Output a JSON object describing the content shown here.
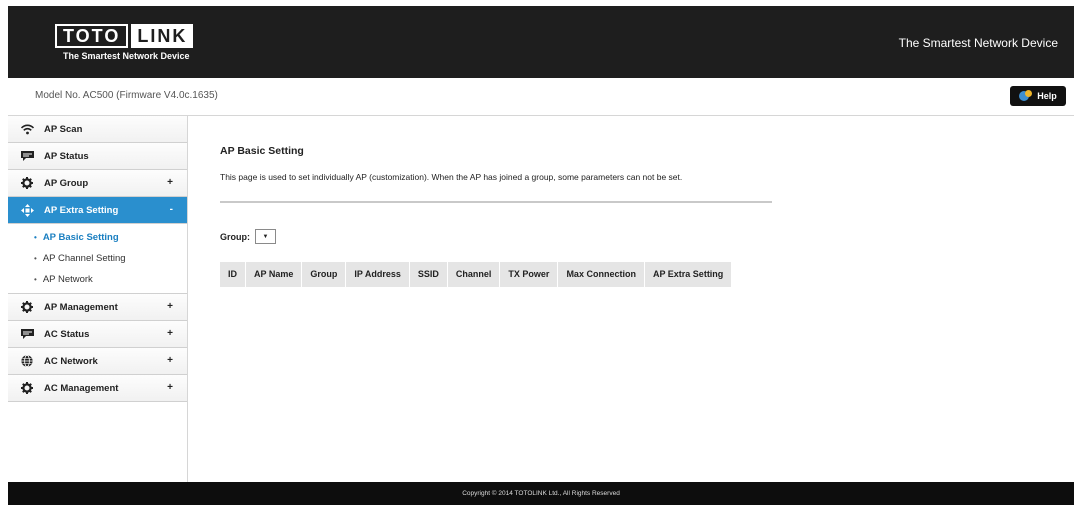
{
  "header": {
    "logo_part1": "TOTO",
    "logo_part2": "LINK",
    "logo_tagline": "The Smartest Network Device",
    "slogan": "The Smartest Network Device"
  },
  "model_bar": {
    "model_text": "Model No. AC500 (Firmware V4.0c.1635)",
    "help_label": "Help"
  },
  "sidebar": {
    "items": [
      {
        "label": "AP Scan",
        "icon": "wifi-icon",
        "expandable": false
      },
      {
        "label": "AP Status",
        "icon": "chat-icon",
        "expandable": false
      },
      {
        "label": "AP Group",
        "icon": "gear-icon",
        "expandable": true,
        "toggle": "+"
      },
      {
        "label": "AP Extra Setting",
        "icon": "arrows-icon",
        "expandable": true,
        "toggle": "-",
        "active": true
      },
      {
        "label": "AP Management",
        "icon": "gear-icon",
        "expandable": true,
        "toggle": "+"
      },
      {
        "label": "AC Status",
        "icon": "chat-icon",
        "expandable": true,
        "toggle": "+"
      },
      {
        "label": "AC Network",
        "icon": "globe-icon",
        "expandable": true,
        "toggle": "+"
      },
      {
        "label": "AC Management",
        "icon": "gear-icon",
        "expandable": true,
        "toggle": "+"
      }
    ],
    "submenu": [
      {
        "label": "AP Basic Setting",
        "active": true
      },
      {
        "label": "AP Channel Setting",
        "active": false
      },
      {
        "label": "AP Network",
        "active": false
      }
    ]
  },
  "main": {
    "title": "AP Basic Setting",
    "description": "This page is used to set individually AP (customization). When the AP has joined a group, some parameters can not be set.",
    "group_label": "Group:",
    "group_value": "",
    "table_headers": [
      "ID",
      "AP Name",
      "Group",
      "IP Address",
      "SSID",
      "Channel",
      "TX Power",
      "Max Connection",
      "AP Extra Setting"
    ]
  },
  "footer": {
    "copyright": "Copyright © 2014 TOTOLINK Ltd.,   All Rights Reserved"
  },
  "colors": {
    "header_bg": "#1e1e1e",
    "active_blue": "#2a8fce",
    "footer_bg": "#0d0d0d"
  }
}
